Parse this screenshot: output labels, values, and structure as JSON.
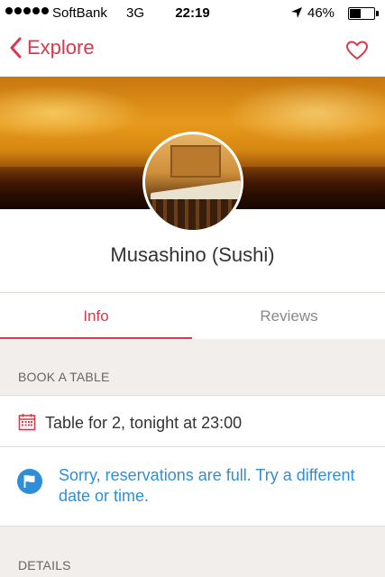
{
  "status_bar": {
    "carrier": "SoftBank",
    "network": "3G",
    "time": "22:19",
    "battery": "46%"
  },
  "nav": {
    "back_label": "Explore"
  },
  "restaurant": {
    "name": "Musashino (Sushi)"
  },
  "tabs": [
    {
      "label": "Info",
      "active": true
    },
    {
      "label": "Reviews",
      "active": false
    }
  ],
  "book": {
    "section_title": "BOOK A TABLE",
    "table_label": "Table for 2, tonight at 23:00",
    "notice": "Sorry, reservations are full. Try a different date or time."
  },
  "details": {
    "section_title": "DETAILS"
  },
  "colors": {
    "accent": "#d9394a",
    "link": "#2e8fd8"
  }
}
